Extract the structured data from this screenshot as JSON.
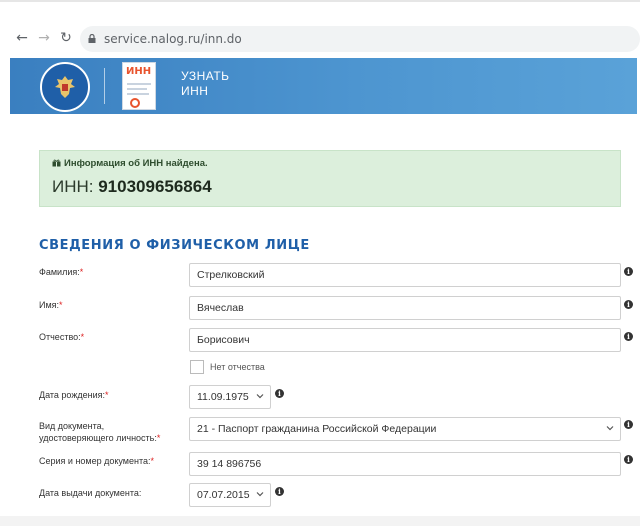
{
  "browser": {
    "url": "service.nalog.ru/inn.do",
    "back_icon": "arrow-left-icon",
    "forward_icon": "arrow-right-icon",
    "reload_icon": "reload-icon"
  },
  "banner": {
    "title_line1": "УЗНАТЬ",
    "title_line2": "ИНН",
    "doc_icon_text": "ИНН",
    "colors": {
      "gradient_start": "#3a7fc0",
      "gradient_end": "#5aa2d8"
    }
  },
  "alert": {
    "message": "Информация об ИНН найдена.",
    "inn_label": "ИНН: ",
    "inn_value": "910309656864",
    "color": "#dcefdc"
  },
  "section": {
    "title": "СВЕДЕНИЯ О ФИЗИЧЕСКОМ ЛИЦЕ"
  },
  "form": {
    "surname": {
      "label": "Фамилия:",
      "required": "*",
      "value": "Стрелковский"
    },
    "name": {
      "label": "Имя:",
      "required": "*",
      "value": "Вячеслав"
    },
    "patronymic": {
      "label": "Отчество:",
      "required": "*",
      "value": "Борисович"
    },
    "no_patronymic": {
      "label": "Нет отчества",
      "checked": false
    },
    "birth_date": {
      "label": "Дата рождения:",
      "required": "*",
      "value": "11.09.1975"
    },
    "doc_type": {
      "label_line1": "Вид документа,",
      "label_line2": "удостоверяющего личность:",
      "required": "*",
      "value": "21 - Паспорт гражданина Российской Федерации"
    },
    "doc_number": {
      "label": "Серия и номер документа:",
      "required": "*",
      "value": "39 14 896756"
    },
    "issue_date": {
      "label": "Дата выдачи документа:",
      "value": "07.07.2015"
    }
  },
  "accent_color": "#1f5fa8",
  "required_color": "#dd2222"
}
